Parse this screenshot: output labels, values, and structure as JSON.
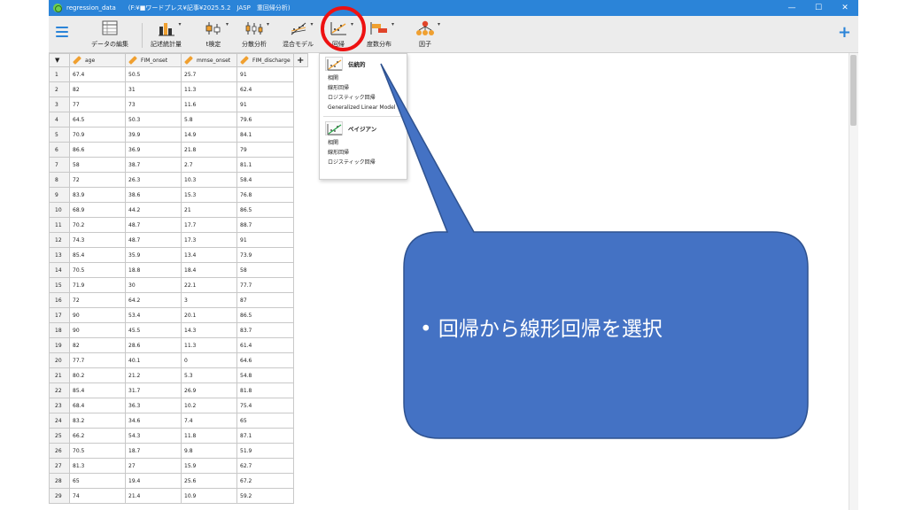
{
  "window": {
    "title": "regression_data",
    "path": "(F:¥■ワードプレス¥記事¥2025.5.2　JASP　重回帰分析)",
    "controls": [
      "—",
      "☐",
      "✕"
    ]
  },
  "ribbon": {
    "buttons": [
      {
        "label": "データの編集",
        "icon": "spreadsheet-icon"
      },
      {
        "label": "記述統計量",
        "icon": "bar-chart-icon"
      },
      {
        "label": "t検定",
        "icon": "t-test-icon"
      },
      {
        "label": "分散分析",
        "icon": "anova-icon"
      },
      {
        "label": "混合モデル",
        "icon": "mixed-models-icon"
      },
      {
        "label": "回帰",
        "icon": "regression-icon"
      },
      {
        "label": "度数分布",
        "icon": "frequencies-icon"
      },
      {
        "label": "因子",
        "icon": "factor-icon"
      }
    ],
    "plus": "+"
  },
  "grid": {
    "filter": "▼",
    "add_column": "+",
    "columns": [
      "age",
      "FIM_onset",
      "mmse_onset",
      "FIM_discharge"
    ],
    "rows": [
      [
        "1",
        "67.4",
        "50.5",
        "25.7",
        "91"
      ],
      [
        "2",
        "82",
        "31",
        "11.3",
        "62.4"
      ],
      [
        "3",
        "77",
        "73",
        "11.6",
        "91"
      ],
      [
        "4",
        "64.5",
        "50.3",
        "5.8",
        "79.6"
      ],
      [
        "5",
        "70.9",
        "39.9",
        "14.9",
        "84.1"
      ],
      [
        "6",
        "86.6",
        "36.9",
        "21.8",
        "79"
      ],
      [
        "7",
        "58",
        "38.7",
        "2.7",
        "81.1"
      ],
      [
        "8",
        "72",
        "26.3",
        "10.3",
        "58.4"
      ],
      [
        "9",
        "83.9",
        "38.6",
        "15.3",
        "76.8"
      ],
      [
        "10",
        "68.9",
        "44.2",
        "21",
        "86.5"
      ],
      [
        "11",
        "70.2",
        "48.7",
        "17.7",
        "88.7"
      ],
      [
        "12",
        "74.3",
        "48.7",
        "17.3",
        "91"
      ],
      [
        "13",
        "85.4",
        "35.9",
        "13.4",
        "73.9"
      ],
      [
        "14",
        "70.5",
        "18.8",
        "18.4",
        "58"
      ],
      [
        "15",
        "71.9",
        "30",
        "22.1",
        "77.7"
      ],
      [
        "16",
        "72",
        "64.2",
        "3",
        "87"
      ],
      [
        "17",
        "90",
        "53.4",
        "20.1",
        "86.5"
      ],
      [
        "18",
        "90",
        "45.5",
        "14.3",
        "83.7"
      ],
      [
        "19",
        "82",
        "28.6",
        "11.3",
        "61.4"
      ],
      [
        "20",
        "77.7",
        "40.1",
        "0",
        "64.6"
      ],
      [
        "21",
        "80.2",
        "21.2",
        "5.3",
        "54.8"
      ],
      [
        "22",
        "85.4",
        "31.7",
        "26.9",
        "81.8"
      ],
      [
        "23",
        "68.4",
        "36.3",
        "10.2",
        "75.4"
      ],
      [
        "24",
        "83.2",
        "34.6",
        "7.4",
        "65"
      ],
      [
        "25",
        "66.2",
        "54.3",
        "11.8",
        "87.1"
      ],
      [
        "26",
        "70.5",
        "18.7",
        "9.8",
        "51.9"
      ],
      [
        "27",
        "81.3",
        "27",
        "15.9",
        "62.7"
      ],
      [
        "28",
        "65",
        "19.4",
        "25.6",
        "67.2"
      ],
      [
        "29",
        "74",
        "21.4",
        "10.9",
        "59.2"
      ]
    ]
  },
  "dropdown": {
    "sections": [
      {
        "title": "伝統的",
        "items": [
          "相関",
          "線形回帰",
          "ロジスティック回帰",
          "Generalized Linear Model"
        ]
      },
      {
        "title": "ベイジアン",
        "items": [
          "相関",
          "線形回帰",
          "ロジスティック回帰"
        ]
      }
    ]
  },
  "callout": {
    "text": "• 回帰から線形回帰を選択",
    "fill": "#4472c4",
    "stroke": "#2f528f"
  },
  "colors": {
    "accent": "#2b84d8",
    "highlight": "#ee1111"
  }
}
